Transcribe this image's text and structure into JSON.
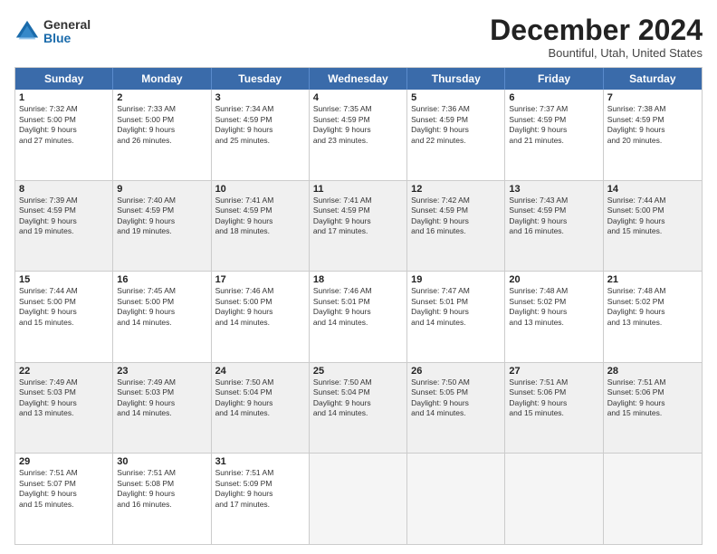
{
  "logo": {
    "general": "General",
    "blue": "Blue"
  },
  "title": "December 2024",
  "location": "Bountiful, Utah, United States",
  "days": [
    "Sunday",
    "Monday",
    "Tuesday",
    "Wednesday",
    "Thursday",
    "Friday",
    "Saturday"
  ],
  "weeks": [
    [
      {
        "day": "1",
        "info": "Sunrise: 7:32 AM\nSunset: 5:00 PM\nDaylight: 9 hours\nand 27 minutes.",
        "shaded": false
      },
      {
        "day": "2",
        "info": "Sunrise: 7:33 AM\nSunset: 5:00 PM\nDaylight: 9 hours\nand 26 minutes.",
        "shaded": false
      },
      {
        "day": "3",
        "info": "Sunrise: 7:34 AM\nSunset: 4:59 PM\nDaylight: 9 hours\nand 25 minutes.",
        "shaded": false
      },
      {
        "day": "4",
        "info": "Sunrise: 7:35 AM\nSunset: 4:59 PM\nDaylight: 9 hours\nand 23 minutes.",
        "shaded": false
      },
      {
        "day": "5",
        "info": "Sunrise: 7:36 AM\nSunset: 4:59 PM\nDaylight: 9 hours\nand 22 minutes.",
        "shaded": false
      },
      {
        "day": "6",
        "info": "Sunrise: 7:37 AM\nSunset: 4:59 PM\nDaylight: 9 hours\nand 21 minutes.",
        "shaded": false
      },
      {
        "day": "7",
        "info": "Sunrise: 7:38 AM\nSunset: 4:59 PM\nDaylight: 9 hours\nand 20 minutes.",
        "shaded": false
      }
    ],
    [
      {
        "day": "8",
        "info": "Sunrise: 7:39 AM\nSunset: 4:59 PM\nDaylight: 9 hours\nand 19 minutes.",
        "shaded": true
      },
      {
        "day": "9",
        "info": "Sunrise: 7:40 AM\nSunset: 4:59 PM\nDaylight: 9 hours\nand 19 minutes.",
        "shaded": true
      },
      {
        "day": "10",
        "info": "Sunrise: 7:41 AM\nSunset: 4:59 PM\nDaylight: 9 hours\nand 18 minutes.",
        "shaded": true
      },
      {
        "day": "11",
        "info": "Sunrise: 7:41 AM\nSunset: 4:59 PM\nDaylight: 9 hours\nand 17 minutes.",
        "shaded": true
      },
      {
        "day": "12",
        "info": "Sunrise: 7:42 AM\nSunset: 4:59 PM\nDaylight: 9 hours\nand 16 minutes.",
        "shaded": true
      },
      {
        "day": "13",
        "info": "Sunrise: 7:43 AM\nSunset: 4:59 PM\nDaylight: 9 hours\nand 16 minutes.",
        "shaded": true
      },
      {
        "day": "14",
        "info": "Sunrise: 7:44 AM\nSunset: 5:00 PM\nDaylight: 9 hours\nand 15 minutes.",
        "shaded": true
      }
    ],
    [
      {
        "day": "15",
        "info": "Sunrise: 7:44 AM\nSunset: 5:00 PM\nDaylight: 9 hours\nand 15 minutes.",
        "shaded": false
      },
      {
        "day": "16",
        "info": "Sunrise: 7:45 AM\nSunset: 5:00 PM\nDaylight: 9 hours\nand 14 minutes.",
        "shaded": false
      },
      {
        "day": "17",
        "info": "Sunrise: 7:46 AM\nSunset: 5:00 PM\nDaylight: 9 hours\nand 14 minutes.",
        "shaded": false
      },
      {
        "day": "18",
        "info": "Sunrise: 7:46 AM\nSunset: 5:01 PM\nDaylight: 9 hours\nand 14 minutes.",
        "shaded": false
      },
      {
        "day": "19",
        "info": "Sunrise: 7:47 AM\nSunset: 5:01 PM\nDaylight: 9 hours\nand 14 minutes.",
        "shaded": false
      },
      {
        "day": "20",
        "info": "Sunrise: 7:48 AM\nSunset: 5:02 PM\nDaylight: 9 hours\nand 13 minutes.",
        "shaded": false
      },
      {
        "day": "21",
        "info": "Sunrise: 7:48 AM\nSunset: 5:02 PM\nDaylight: 9 hours\nand 13 minutes.",
        "shaded": false
      }
    ],
    [
      {
        "day": "22",
        "info": "Sunrise: 7:49 AM\nSunset: 5:03 PM\nDaylight: 9 hours\nand 13 minutes.",
        "shaded": true
      },
      {
        "day": "23",
        "info": "Sunrise: 7:49 AM\nSunset: 5:03 PM\nDaylight: 9 hours\nand 14 minutes.",
        "shaded": true
      },
      {
        "day": "24",
        "info": "Sunrise: 7:50 AM\nSunset: 5:04 PM\nDaylight: 9 hours\nand 14 minutes.",
        "shaded": true
      },
      {
        "day": "25",
        "info": "Sunrise: 7:50 AM\nSunset: 5:04 PM\nDaylight: 9 hours\nand 14 minutes.",
        "shaded": true
      },
      {
        "day": "26",
        "info": "Sunrise: 7:50 AM\nSunset: 5:05 PM\nDaylight: 9 hours\nand 14 minutes.",
        "shaded": true
      },
      {
        "day": "27",
        "info": "Sunrise: 7:51 AM\nSunset: 5:06 PM\nDaylight: 9 hours\nand 15 minutes.",
        "shaded": true
      },
      {
        "day": "28",
        "info": "Sunrise: 7:51 AM\nSunset: 5:06 PM\nDaylight: 9 hours\nand 15 minutes.",
        "shaded": true
      }
    ],
    [
      {
        "day": "29",
        "info": "Sunrise: 7:51 AM\nSunset: 5:07 PM\nDaylight: 9 hours\nand 15 minutes.",
        "shaded": false
      },
      {
        "day": "30",
        "info": "Sunrise: 7:51 AM\nSunset: 5:08 PM\nDaylight: 9 hours\nand 16 minutes.",
        "shaded": false
      },
      {
        "day": "31",
        "info": "Sunrise: 7:51 AM\nSunset: 5:09 PM\nDaylight: 9 hours\nand 17 minutes.",
        "shaded": false
      },
      {
        "day": "",
        "info": "",
        "shaded": false,
        "empty": true
      },
      {
        "day": "",
        "info": "",
        "shaded": false,
        "empty": true
      },
      {
        "day": "",
        "info": "",
        "shaded": false,
        "empty": true
      },
      {
        "day": "",
        "info": "",
        "shaded": false,
        "empty": true
      }
    ]
  ]
}
